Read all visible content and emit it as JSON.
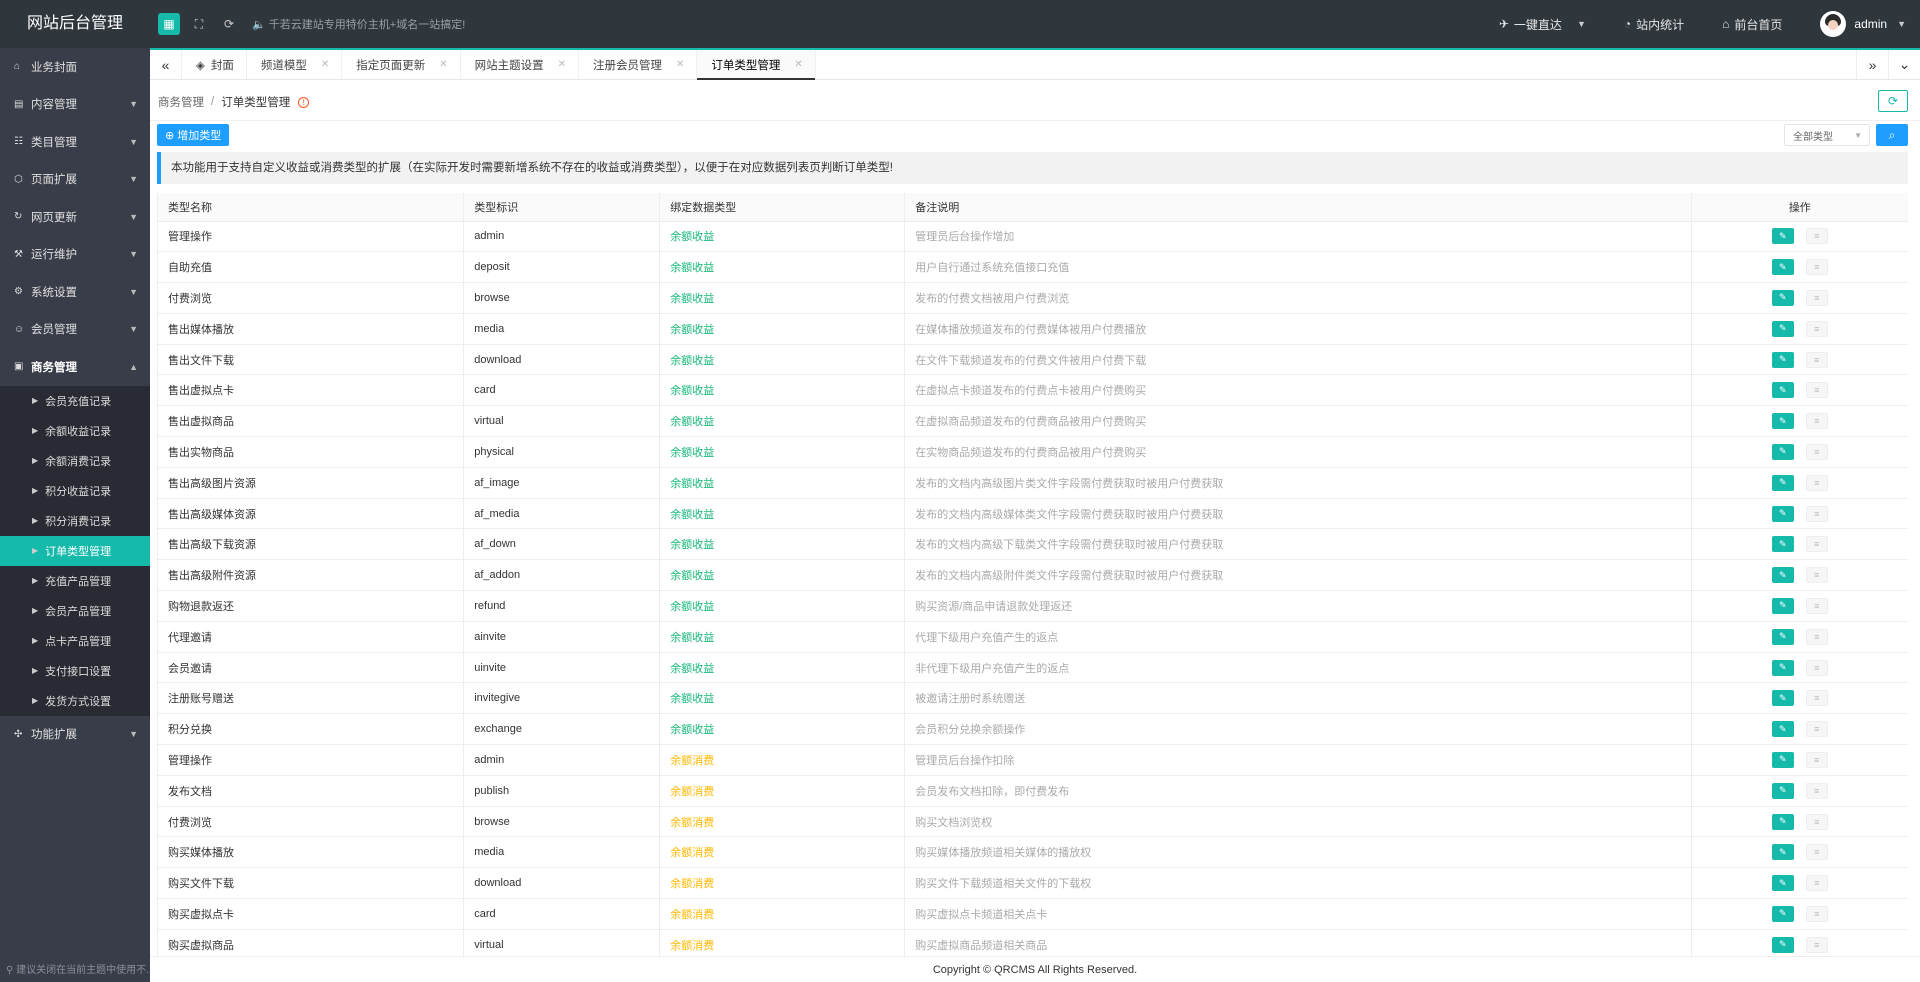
{
  "app": {
    "brand": "网站后台管理",
    "notice": "千若云建站专用特价主机+域名一站搞定!",
    "links": {
      "quick": "一键直达",
      "stats": "站内统计",
      "home": "前台首页"
    },
    "user": "admin"
  },
  "sidebar": {
    "items": [
      {
        "label": "业务封面",
        "icon": "home-icon"
      },
      {
        "label": "内容管理",
        "icon": "document-icon"
      },
      {
        "label": "类目管理",
        "icon": "category-icon"
      },
      {
        "label": "页面扩展",
        "icon": "package-icon"
      },
      {
        "label": "网页更新",
        "icon": "refresh-icon"
      },
      {
        "label": "运行维护",
        "icon": "wrench-icon"
      },
      {
        "label": "系统设置",
        "icon": "gear-icon"
      },
      {
        "label": "会员管理",
        "icon": "user-icon"
      },
      {
        "label": "商务管理",
        "icon": "briefcase-icon"
      }
    ],
    "sub_items": [
      {
        "label": "会员充值记录",
        "active": false
      },
      {
        "label": "余额收益记录",
        "active": false
      },
      {
        "label": "余额消费记录",
        "active": false
      },
      {
        "label": "积分收益记录",
        "active": false
      },
      {
        "label": "积分消费记录",
        "active": false
      },
      {
        "label": "订单类型管理",
        "active": true
      },
      {
        "label": "充值产品管理",
        "active": false
      },
      {
        "label": "会员产品管理",
        "active": false
      },
      {
        "label": "点卡产品管理",
        "active": false
      },
      {
        "label": "支付接口设置",
        "active": false
      },
      {
        "label": "发货方式设置",
        "active": false
      }
    ],
    "after_items": [
      {
        "label": "功能扩展",
        "icon": "puzzle-icon"
      }
    ],
    "footer": "建议关闭在当前主题中使用不..."
  },
  "tabs": [
    {
      "label": "封面",
      "closable": false,
      "active": false
    },
    {
      "label": "频道模型",
      "closable": true,
      "active": false
    },
    {
      "label": "指定页面更新",
      "closable": true,
      "active": false
    },
    {
      "label": "网站主题设置",
      "closable": true,
      "active": false
    },
    {
      "label": "注册会员管理",
      "closable": true,
      "active": false
    },
    {
      "label": "订单类型管理",
      "closable": true,
      "active": true
    }
  ],
  "main": {
    "breadcrumb": {
      "parent": "商务管理",
      "sep": "/",
      "current": "订单类型管理"
    },
    "add_button": "增加类型",
    "type_select": "全部类型",
    "tip": "本功能用于支持自定义收益或消费类型的扩展（在实际开发时需要新增系统不存在的收益或消费类型），以便于在对应数据列表页判断订单类型!",
    "table": {
      "headers": [
        "类型名称",
        "类型标识",
        "绑定数据类型",
        "备注说明",
        "操作"
      ],
      "rows": [
        {
          "name": "管理操作",
          "code": "admin",
          "type": "余额收益",
          "kind": "income",
          "note": "管理员后台操作增加"
        },
        {
          "name": "自助充值",
          "code": "deposit",
          "type": "余额收益",
          "kind": "income",
          "note": "用户自行通过系统充值接口充值"
        },
        {
          "name": "付费浏览",
          "code": "browse",
          "type": "余额收益",
          "kind": "income",
          "note": "发布的付费文档被用户付费浏览"
        },
        {
          "name": "售出媒体播放",
          "code": "media",
          "type": "余额收益",
          "kind": "income",
          "note": "在媒体播放频道发布的付费媒体被用户付费播放"
        },
        {
          "name": "售出文件下载",
          "code": "download",
          "type": "余额收益",
          "kind": "income",
          "note": "在文件下载频道发布的付费文件被用户付费下载"
        },
        {
          "name": "售出虚拟点卡",
          "code": "card",
          "type": "余额收益",
          "kind": "income",
          "note": "在虚拟点卡频道发布的付费点卡被用户付费购买"
        },
        {
          "name": "售出虚拟商品",
          "code": "virtual",
          "type": "余额收益",
          "kind": "income",
          "note": "在虚拟商品频道发布的付费商品被用户付费购买"
        },
        {
          "name": "售出实物商品",
          "code": "physical",
          "type": "余额收益",
          "kind": "income",
          "note": "在实物商品频道发布的付费商品被用户付费购买"
        },
        {
          "name": "售出高级图片资源",
          "code": "af_image",
          "type": "余额收益",
          "kind": "income",
          "note": "发布的文档内高级图片类文件字段需付费获取时被用户付费获取"
        },
        {
          "name": "售出高级媒体资源",
          "code": "af_media",
          "type": "余额收益",
          "kind": "income",
          "note": "发布的文档内高级媒体类文件字段需付费获取时被用户付费获取"
        },
        {
          "name": "售出高级下载资源",
          "code": "af_down",
          "type": "余额收益",
          "kind": "income",
          "note": "发布的文档内高级下载类文件字段需付费获取时被用户付费获取"
        },
        {
          "name": "售出高级附件资源",
          "code": "af_addon",
          "type": "余额收益",
          "kind": "income",
          "note": "发布的文档内高级附件类文件字段需付费获取时被用户付费获取"
        },
        {
          "name": "购物退款返还",
          "code": "refund",
          "type": "余额收益",
          "kind": "income",
          "note": "购买资源/商品申请退款处理返还"
        },
        {
          "name": "代理邀请",
          "code": "ainvite",
          "type": "余额收益",
          "kind": "income",
          "note": "代理下级用户充值产生的返点"
        },
        {
          "name": "会员邀请",
          "code": "uinvite",
          "type": "余额收益",
          "kind": "income",
          "note": "非代理下级用户充值产生的返点"
        },
        {
          "name": "注册账号赠送",
          "code": "invitegive",
          "type": "余额收益",
          "kind": "income",
          "note": "被邀请注册时系统赠送"
        },
        {
          "name": "积分兑换",
          "code": "exchange",
          "type": "余额收益",
          "kind": "income",
          "note": "会员积分兑换余额操作"
        },
        {
          "name": "管理操作",
          "code": "admin",
          "type": "余额消费",
          "kind": "expense",
          "note": "管理员后台操作扣除"
        },
        {
          "name": "发布文档",
          "code": "publish",
          "type": "余额消费",
          "kind": "expense",
          "note": "会员发布文档扣除，即付费发布"
        },
        {
          "name": "付费浏览",
          "code": "browse",
          "type": "余额消费",
          "kind": "expense",
          "note": "购买文档浏览权"
        },
        {
          "name": "购买媒体播放",
          "code": "media",
          "type": "余额消费",
          "kind": "expense",
          "note": "购买媒体播放频道相关媒体的播放权"
        },
        {
          "name": "购买文件下载",
          "code": "download",
          "type": "余额消费",
          "kind": "expense",
          "note": "购买文件下载频道相关文件的下载权"
        },
        {
          "name": "购买虚拟点卡",
          "code": "card",
          "type": "余额消费",
          "kind": "expense",
          "note": "购买虚拟点卡频道相关点卡"
        },
        {
          "name": "购买虚拟商品",
          "code": "virtual",
          "type": "余额消费",
          "kind": "expense",
          "note": "购买虚拟商品频道相关商品"
        }
      ]
    }
  },
  "footer": "Copyright © QRCMS All Rights Reserved."
}
